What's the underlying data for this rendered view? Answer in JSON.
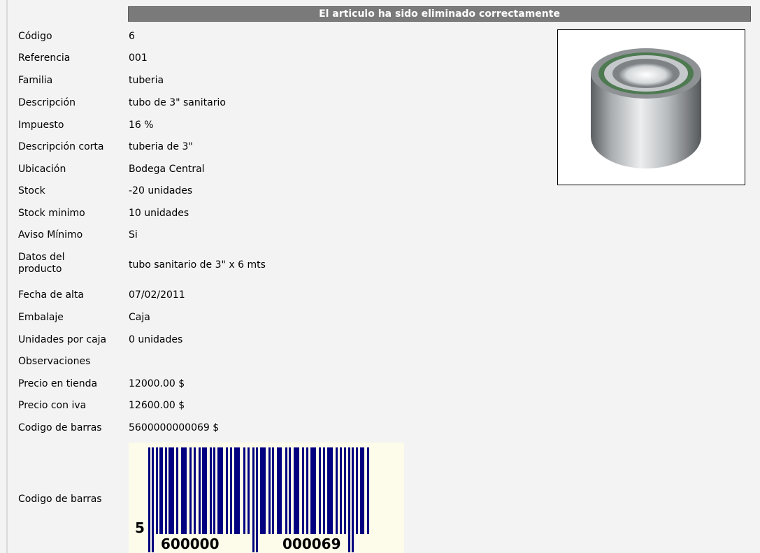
{
  "banner": {
    "message": "El articulo ha sido eliminado correctamente"
  },
  "fields": [
    {
      "label": "Código",
      "value": "6"
    },
    {
      "label": "Referencia",
      "value": "001"
    },
    {
      "label": "Familia",
      "value": "tuberia"
    },
    {
      "label": "Descripción",
      "value": "tubo de 3\" sanitario"
    },
    {
      "label": "Impuesto",
      "value": "16 %"
    },
    {
      "label": "Descripción corta",
      "value": "tuberia de 3\""
    },
    {
      "label": "Ubicación",
      "value": "Bodega Central"
    },
    {
      "label": "Stock",
      "value": "-20 unidades"
    },
    {
      "label": "Stock minimo",
      "value": "10 unidades"
    },
    {
      "label": "Aviso Mínimo",
      "value": "Si"
    },
    {
      "label": "Datos del producto",
      "value": "tubo sanitario de 3\" x 6 mts"
    },
    {
      "label": "Fecha de alta",
      "value": "07/02/2011"
    },
    {
      "label": "Embalaje",
      "value": "Caja"
    },
    {
      "label": "Unidades por caja",
      "value": "0 unidades"
    },
    {
      "label": "Observaciones",
      "value": ""
    },
    {
      "label": "Precio en tienda",
      "value": "12000.00 $"
    },
    {
      "label": "Precio con iva",
      "value": "12600.00 $"
    },
    {
      "label": "Codigo de barras",
      "value": "5600000000069 $"
    }
  ],
  "barcode_row": {
    "label": "Codigo de barras",
    "first_digit": "5",
    "left_group": "600000",
    "right_group": "000069"
  }
}
